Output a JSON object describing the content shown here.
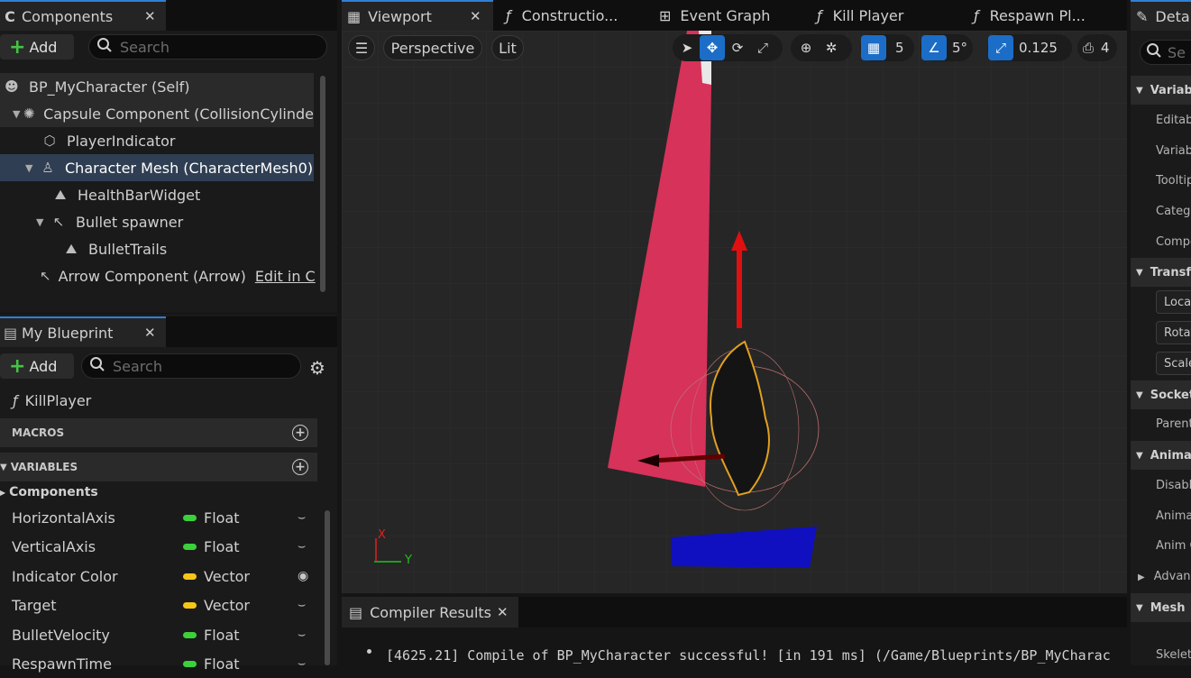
{
  "components_panel": {
    "tab_label": "Components",
    "add_label": "Add",
    "search_placeholder": "Search",
    "tree": [
      {
        "label": "BP_MyCharacter (Self)",
        "icon": "self-icon"
      },
      {
        "label": "Capsule Component (CollisionCylinde",
        "icon": "capsule-icon"
      },
      {
        "label": "PlayerIndicator",
        "icon": "static-mesh-icon"
      },
      {
        "label": "Character Mesh (CharacterMesh0)",
        "icon": "skeletal-mesh-icon"
      },
      {
        "label": "HealthBarWidget",
        "icon": "widget-icon"
      },
      {
        "label": "Bullet spawner",
        "icon": "arrow-icon"
      },
      {
        "label": "BulletTrails",
        "icon": "particle-icon"
      },
      {
        "label": "Arrow Component (Arrow)",
        "icon": "arrow-icon",
        "link": "Edit in C"
      }
    ]
  },
  "blueprint_panel": {
    "tab_label": "My Blueprint",
    "add_label": "Add",
    "search_placeholder": "Search",
    "function_item": "KillPlayer",
    "macros_label": "MACROS",
    "variables_label": "VARIABLES",
    "components_category": "Components",
    "variables": [
      {
        "name": "HorizontalAxis",
        "type": "Float",
        "color": "#3ad13a"
      },
      {
        "name": "VerticalAxis",
        "type": "Float",
        "color": "#3ad13a"
      },
      {
        "name": "Indicator Color",
        "type": "Vector",
        "color": "#f5c518"
      },
      {
        "name": "Target",
        "type": "Vector",
        "color": "#f5c518"
      },
      {
        "name": "BulletVelocity",
        "type": "Float",
        "color": "#3ad13a"
      },
      {
        "name": "RespawnTime",
        "type": "Float",
        "color": "#3ad13a"
      }
    ]
  },
  "editor_tabs": {
    "viewport": "Viewport",
    "construction": "Constructio...",
    "event_graph": "Event Graph",
    "kill_player": "Kill Player",
    "respawn": "Respawn Pl..."
  },
  "viewport_toolbar": {
    "perspective": "Perspective",
    "lit": "Lit",
    "grid_snap": "5",
    "rotation_snap": "5°",
    "scale_snap": "0.125",
    "camera_speed": "4"
  },
  "axis_gizmo": {
    "x": "X",
    "y": "Y"
  },
  "compiler": {
    "tab_label": "Compiler Results",
    "message": "[4625.21] Compile of BP_MyCharacter successful! [in 191 ms] (/Game/Blueprints/BP_MyCharac"
  },
  "details_panel": {
    "tab_label": "Deta",
    "search_placeholder": "Se",
    "sections": {
      "variable": "Variabl",
      "transform": "Transf",
      "sockets": "Socket",
      "animation": "Animat",
      "mesh": "Mesh"
    },
    "rows": {
      "editable": "Editabl",
      "variable": "Variabl",
      "tooltip": "Tooltip",
      "category": "Catego",
      "component": "Compo",
      "location": "Loca",
      "rotation": "Rotat",
      "scale": "Scale",
      "parent": "Parent",
      "disable": "Disable",
      "animation_mode": "Animat",
      "anim_class": "Anim C",
      "advanced": "Advanc",
      "skeletal": "Skeleta"
    }
  },
  "colors": {
    "accent": "#1b6dc7",
    "selection": "#2f3e52",
    "float_pin": "#3ad13a",
    "vector_pin": "#f5c518"
  }
}
